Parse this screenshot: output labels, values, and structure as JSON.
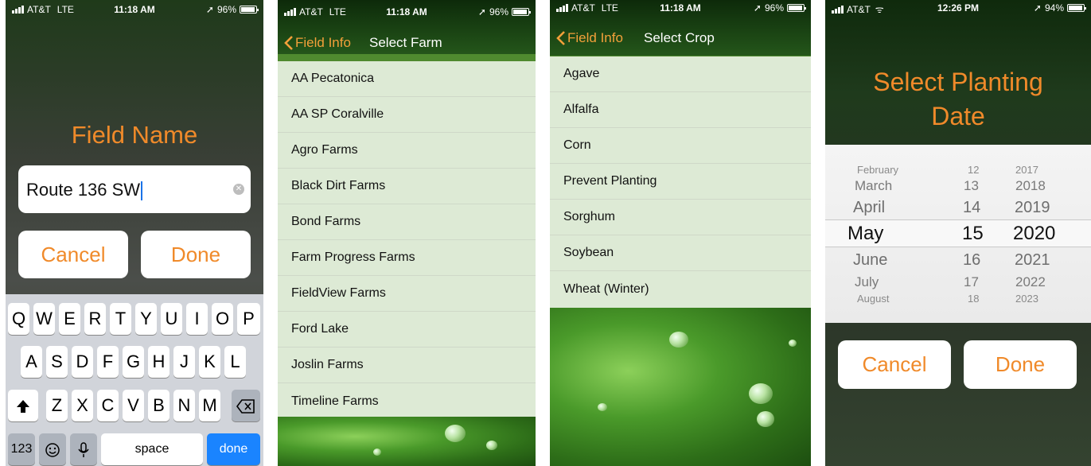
{
  "colors": {
    "accent": "#f08a2a",
    "keyboard_done": "#1a84ff"
  },
  "screen1": {
    "status": {
      "carrier": "AT&T",
      "network": "LTE",
      "time": "11:18 AM",
      "battery": "96%"
    },
    "title": "Field Name",
    "input_value": "Route 136 SW",
    "cancel_label": "Cancel",
    "done_label": "Done",
    "keyboard": {
      "row1": [
        "Q",
        "W",
        "E",
        "R",
        "T",
        "Y",
        "U",
        "I",
        "O",
        "P"
      ],
      "row2": [
        "A",
        "S",
        "D",
        "F",
        "G",
        "H",
        "J",
        "K",
        "L"
      ],
      "row3": [
        "Z",
        "X",
        "C",
        "V",
        "B",
        "N",
        "M"
      ],
      "numbers_label": "123",
      "space_label": "space",
      "done_label": "done",
      "icons": [
        "shift-icon",
        "backspace-icon",
        "emoji-icon",
        "microphone-icon"
      ]
    }
  },
  "screen2": {
    "status": {
      "carrier": "AT&T",
      "network": "LTE",
      "time": "11:18 AM",
      "battery": "96%"
    },
    "back_label": "Field Info",
    "title": "Select Farm",
    "items": [
      "AA Pecatonica",
      "AA SP Coralville",
      "Agro Farms",
      "Black Dirt Farms",
      "Bond Farms",
      "Farm Progress Farms",
      "FieldView Farms",
      "Ford Lake",
      "Joslin Farms",
      "Timeline Farms"
    ]
  },
  "screen3": {
    "status": {
      "carrier": "AT&T",
      "network": "LTE",
      "time": "11:18 AM",
      "battery": "96%"
    },
    "back_label": "Field Info",
    "title": "Select Crop",
    "items": [
      "Agave",
      "Alfalfa",
      "Corn",
      "Prevent Planting",
      "Sorghum",
      "Soybean",
      "Wheat (Winter)"
    ]
  },
  "screen4": {
    "status": {
      "carrier": "AT&T",
      "time": "12:26 PM",
      "battery": "94%"
    },
    "title_line1": "Select Planting",
    "title_line2": "Date",
    "picker": {
      "months": [
        "February",
        "March",
        "April",
        "May",
        "June",
        "July",
        "August"
      ],
      "days": [
        "12",
        "13",
        "14",
        "15",
        "16",
        "17",
        "18"
      ],
      "years": [
        "2017",
        "2018",
        "2019",
        "2020",
        "2021",
        "2022",
        "2023"
      ],
      "selected": {
        "month": "May",
        "day": "15",
        "year": "2020"
      }
    },
    "cancel_label": "Cancel",
    "done_label": "Done"
  }
}
